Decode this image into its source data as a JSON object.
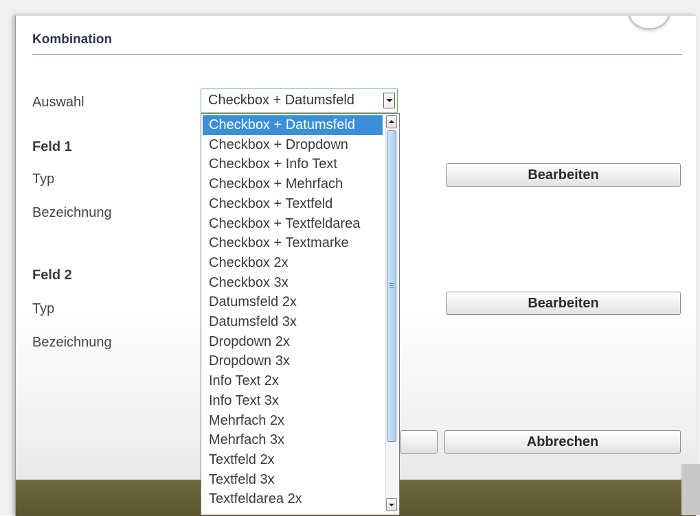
{
  "dialog": {
    "title": "Kombination"
  },
  "form": {
    "auswahl_label": "Auswahl",
    "auswahl_value": "Checkbox + Datumsfeld",
    "feld1": {
      "heading": "Feld 1",
      "typ_label": "Typ",
      "bezeichnung_label": "Bezeichnung",
      "edit_button": "Bearbeiten"
    },
    "feld2": {
      "heading": "Feld 2",
      "typ_label": "Typ",
      "bezeichnung_label": "Bezeichnung",
      "edit_button": "Bearbeiten"
    },
    "cancel_button": "Abbrechen"
  },
  "dropdown": {
    "selected_index": 0,
    "options": [
      "Checkbox + Datumsfeld",
      "Checkbox + Dropdown",
      "Checkbox + Info Text",
      "Checkbox + Mehrfach",
      "Checkbox + Textfeld",
      "Checkbox + Textfeldarea",
      "Checkbox + Textmarke",
      "Checkbox 2x",
      "Checkbox 3x",
      "Datumsfeld 2x",
      "Datumsfeld 3x",
      "Dropdown 2x",
      "Dropdown 3x",
      "Info Text 2x",
      "Info Text 3x",
      "Mehrfach 2x",
      "Mehrfach 3x",
      "Textfeld 2x",
      "Textfeld 3x",
      "Textfeldarea 2x"
    ]
  },
  "colors": {
    "selected_option_bg": "#3b8fd6",
    "select_border": "#5cb85c",
    "title_color": "#2f3550",
    "footer_bar": "#6b653a"
  }
}
